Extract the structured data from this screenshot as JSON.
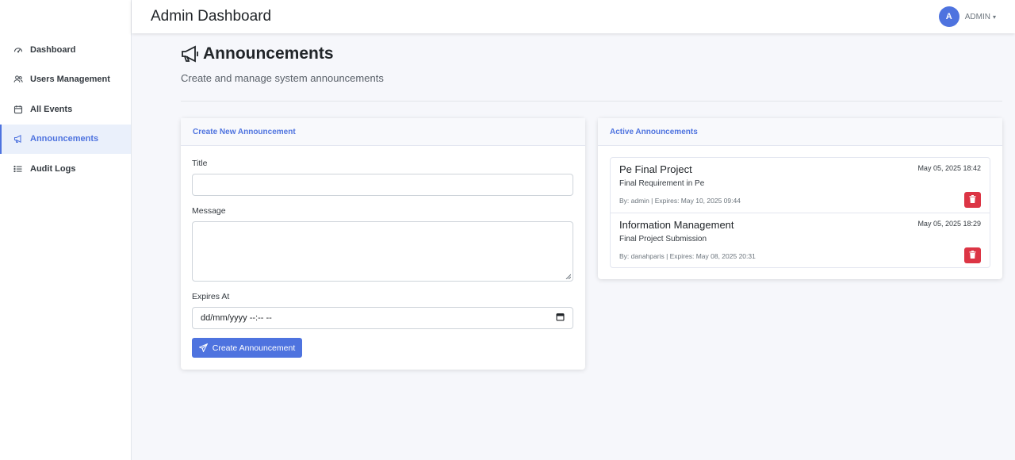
{
  "app": {
    "title": "Admin Dashboard"
  },
  "user": {
    "initial": "A",
    "name": "ADMIN"
  },
  "sidebar": {
    "items": [
      {
        "label": "Dashboard",
        "icon": "gauge-icon"
      },
      {
        "label": "Users Management",
        "icon": "users-icon"
      },
      {
        "label": "All Events",
        "icon": "calendar-icon"
      },
      {
        "label": "Announcements",
        "icon": "megaphone-icon",
        "active": true
      },
      {
        "label": "Audit Logs",
        "icon": "list-icon"
      }
    ]
  },
  "page": {
    "title": "Announcements",
    "subtitle": "Create and manage system announcements"
  },
  "create_form": {
    "header": "Create New Announcement",
    "title_label": "Title",
    "title_value": "",
    "message_label": "Message",
    "message_value": "",
    "expires_label": "Expires At",
    "expires_placeholder": "dd/mm/yyyy --:-- --",
    "submit_label": "Create Announcement"
  },
  "active_announcements": {
    "header": "Active Announcements",
    "items": [
      {
        "title": "Pe Final Project",
        "date": "May 05, 2025 18:42",
        "message": "Final Requirement in Pe",
        "meta": "By: admin | Expires: May 10, 2025 09:44"
      },
      {
        "title": "Information Management",
        "date": "May 05, 2025 18:29",
        "message": "Final Project Submission",
        "meta": "By: danahparis | Expires: May 08, 2025 20:31"
      }
    ]
  },
  "colors": {
    "accent": "#4e73df",
    "danger": "#dc3545",
    "background": "#f6f7fb"
  }
}
